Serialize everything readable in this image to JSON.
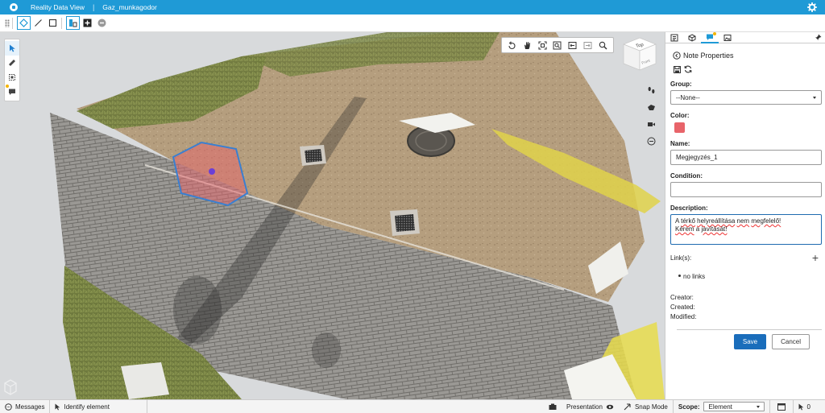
{
  "titlebar": {
    "app_title": "Reality Data View",
    "separator": "|",
    "project_name": "Gaz_munkagodor"
  },
  "toolbar": {
    "tools": [
      "grip-icon",
      "select-point-icon",
      "draw-line-icon",
      "rectangle-icon",
      "section-icon",
      "add-icon",
      "clear-icon"
    ]
  },
  "view_cube": {
    "top_label": "Top",
    "front_label": "Front"
  },
  "panel": {
    "title": "Note Properties",
    "group_label": "Group:",
    "group_value": "--None--",
    "color_label": "Color:",
    "color_value": "#e8646a",
    "name_label": "Name:",
    "name_value": "Megjegyzés_1",
    "condition_label": "Condition:",
    "condition_value": "",
    "description_label": "Description:",
    "description_parts": {
      "p1": "A ",
      "w1": "térkő",
      "p2": " ",
      "w2": "helyreállítása",
      "p3": " ",
      "w3": "nem",
      "p4": " ",
      "w4": "megfelelő!",
      "w5": "Kérem",
      "p5": " a ",
      "w6": "javítását!"
    },
    "links_label": "Link(s):",
    "add_link_symbol": "+",
    "no_links": "no links",
    "creator_label": "Creator:",
    "created_label": "Created:",
    "modified_label": "Modified:",
    "save_label": "Save",
    "cancel_label": "Cancel"
  },
  "statusbar": {
    "messages": "Messages",
    "identify": "Identify element",
    "presentation": "Presentation",
    "snap_mode": "Snap Mode",
    "scope_label": "Scope:",
    "scope_value": "Element",
    "selection_count": "0"
  },
  "colors": {
    "accent": "#1f9ad6",
    "primary_button": "#1a6dbb",
    "note_fill": "#e8646a"
  }
}
